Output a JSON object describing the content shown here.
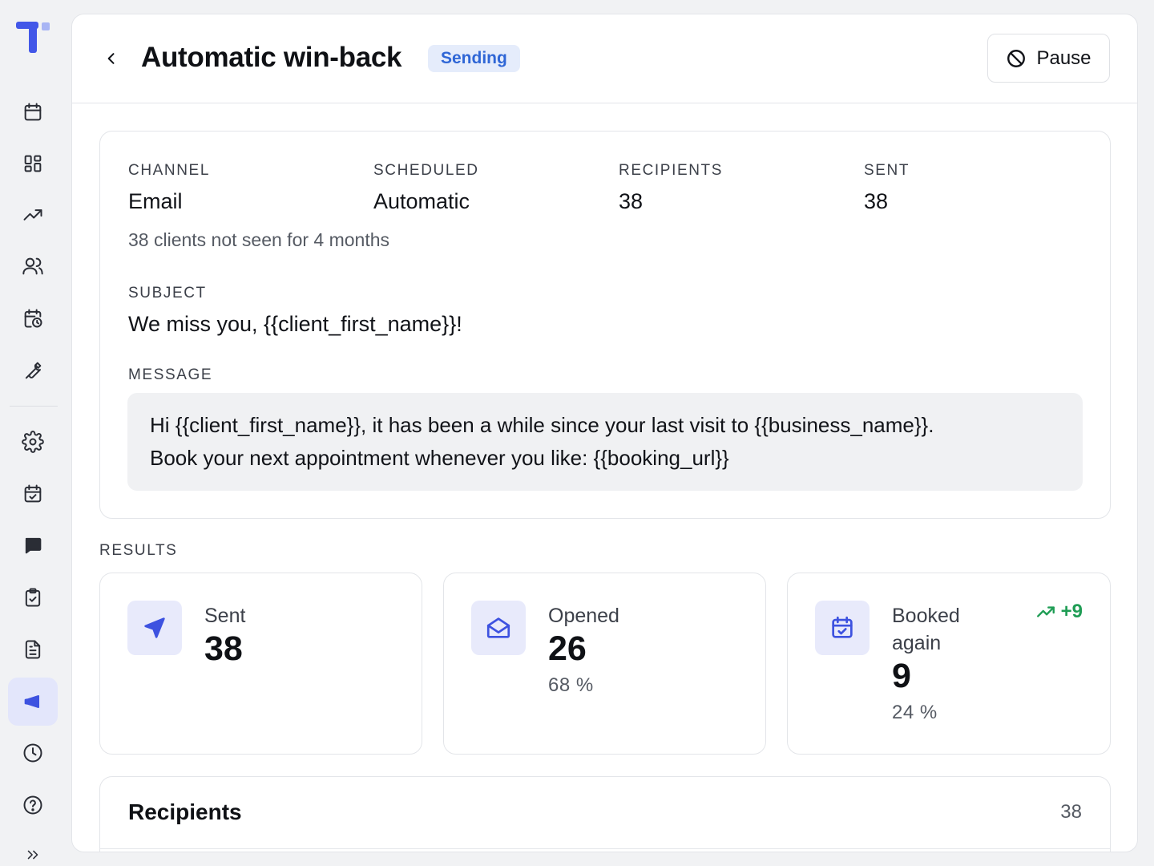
{
  "nav": {
    "items": [
      {
        "icon": "calendar-icon",
        "label": "Calendar"
      },
      {
        "icon": "dashboard-icon",
        "label": "Dashboard"
      },
      {
        "icon": "trending-icon",
        "label": "Reports"
      },
      {
        "icon": "users-icon",
        "label": "Clients"
      },
      {
        "icon": "calendar-clock-icon",
        "label": "Schedule"
      },
      {
        "icon": "wrench-icon",
        "label": "Services"
      },
      {
        "icon": "gear-icon",
        "label": "Settings"
      },
      {
        "icon": "calendar-check-icon",
        "label": "Bookings"
      },
      {
        "icon": "chat-icon",
        "label": "Messages"
      },
      {
        "icon": "clipboard-check-icon",
        "label": "Tasks"
      },
      {
        "icon": "document-icon",
        "label": "Documents"
      },
      {
        "icon": "megaphone-icon",
        "label": "Campaigns",
        "active": true
      },
      {
        "icon": "clock-icon",
        "label": "History"
      },
      {
        "icon": "help-icon",
        "label": "Help"
      },
      {
        "icon": "chevrons-right-icon",
        "label": "Expand"
      }
    ]
  },
  "header": {
    "title": "Automatic win-back",
    "status": "Sending",
    "pause_label": "Pause"
  },
  "details": {
    "channel_label": "CHANNEL",
    "channel_value": "Email",
    "scheduled_label": "SCHEDULED",
    "scheduled_value": "Automatic",
    "recipients_label": "RECIPIENTS",
    "recipients_value": "38",
    "sent_label": "SENT",
    "sent_value": "38",
    "audience": "38 clients not seen for 4 months",
    "subject_label": "SUBJECT",
    "subject_value": "We miss you, {{client_first_name}}!",
    "message_label": "MESSAGE",
    "message_line1": "Hi {{client_first_name}}, it has been a while since your last visit to {{business_name}}.",
    "message_line2": "Book your next appointment whenever you like: {{booking_url}}"
  },
  "results": {
    "label": "RESULTS",
    "sent": {
      "label": "Sent",
      "value": "38"
    },
    "opened": {
      "label": "Opened",
      "value": "26",
      "percent": "68 %"
    },
    "booked": {
      "label_line1": "Booked",
      "label_line2": "again",
      "value": "9",
      "percent": "24 %",
      "trend": "+9"
    }
  },
  "recipients": {
    "title": "Recipients",
    "count": "38"
  },
  "colors": {
    "accent": "#3d52e0",
    "badge_bg": "#e5ecfb",
    "badge_text": "#2f66d6",
    "trend_green": "#1f9d55"
  }
}
